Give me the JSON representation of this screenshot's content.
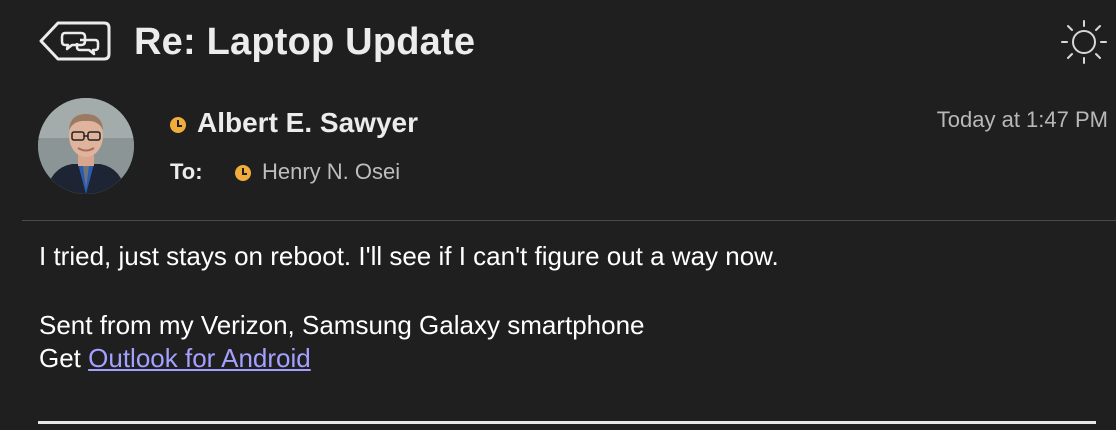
{
  "header": {
    "subject": "Re: Laptop Update"
  },
  "message": {
    "sender": {
      "name": "Albert E. Sawyer",
      "status_color": "#f0ad3c"
    },
    "to_label": "To:",
    "recipient": {
      "name": "Henry N. Osei",
      "status_color": "#f0ad3c"
    },
    "timestamp": "Today at 1:47 PM",
    "body": {
      "line1": "I tried, just stays on reboot. I'll see if I can't figure out a way now.",
      "signature_line": "Sent from my Verizon, Samsung Galaxy smartphone",
      "get_prefix": "Get ",
      "link_text": "Outlook for Android"
    }
  },
  "colors": {
    "background": "#1f1f1f",
    "link": "#a3a0ff",
    "presence_away": "#f0ad3c"
  },
  "icons": {
    "back": "back-conversation-icon",
    "theme": "sun-icon"
  }
}
